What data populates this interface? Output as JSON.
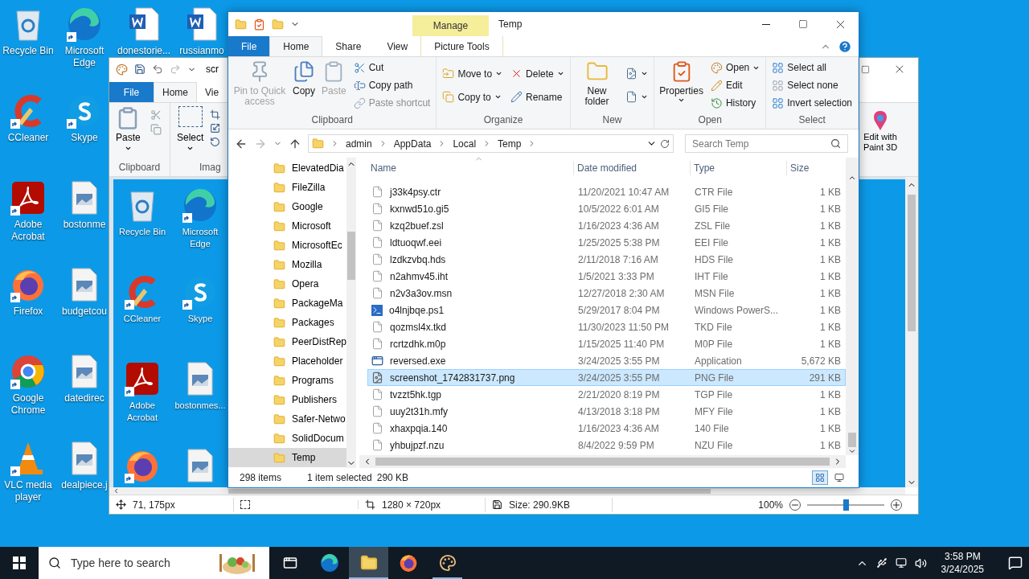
{
  "desktop_columns": [
    [
      {
        "label": "Recycle Bin",
        "kind": "recycle",
        "shortcut": false
      },
      {
        "label": "CCleaner",
        "kind": "ccleaner",
        "shortcut": true
      },
      {
        "label": "Adobe Acrobat",
        "kind": "acrobat",
        "shortcut": true
      },
      {
        "label": "Firefox",
        "kind": "firefox",
        "shortcut": true
      },
      {
        "label": "Google Chrome",
        "kind": "chrome",
        "shortcut": true
      },
      {
        "label": "VLC media player",
        "kind": "vlc",
        "shortcut": true
      }
    ],
    [
      {
        "label": "Microsoft Edge",
        "kind": "edge",
        "shortcut": true
      },
      {
        "label": "Skype",
        "kind": "skype",
        "shortcut": true
      },
      {
        "label": "bostonme",
        "kind": "image",
        "shortcut": false
      },
      {
        "label": "budgetcou",
        "kind": "image",
        "shortcut": false
      },
      {
        "label": "datedirec",
        "kind": "image",
        "shortcut": false
      },
      {
        "label": "dealpiece.j",
        "kind": "image",
        "shortcut": false
      }
    ],
    [
      {
        "label": "donestorie...",
        "kind": "word",
        "shortcut": false
      }
    ],
    [
      {
        "label": "russianmo",
        "kind": "word",
        "shortcut": false
      }
    ]
  ],
  "paint": {
    "title": "scr",
    "tabs": [
      {
        "label": "File",
        "kind": "file",
        "selected": false
      },
      {
        "label": "Home",
        "kind": "tab",
        "selected": true
      },
      {
        "label": "Vie",
        "kind": "tab",
        "selected": false
      }
    ],
    "ribbon": {
      "paste": "Paste",
      "select": "Select",
      "groups": [
        "Clipboard",
        "Imag"
      ]
    },
    "edit_3d": "Edit with Paint 3D",
    "canvas_icons": [
      {
        "label": "Recycle Bin",
        "kind": "recycle",
        "shortcut": false
      },
      {
        "label": "Microsoft Edge",
        "kind": "edge",
        "shortcut": true
      },
      {
        "label": "CCleaner",
        "kind": "ccleaner",
        "shortcut": true
      },
      {
        "label": "Skype",
        "kind": "skype",
        "shortcut": true
      },
      {
        "label": "Adobe Acrobat",
        "kind": "acrobat",
        "shortcut": true
      },
      {
        "label": "bostonmes...",
        "kind": "image",
        "shortcut": false
      },
      {
        "kind": "firefox",
        "shortcut": true
      },
      {
        "kind": "image",
        "shortcut": false
      }
    ],
    "status": {
      "position": "71, 175px",
      "dimensions": "1280 × 720px",
      "size": "Size: 290.9KB",
      "zoom": "100%",
      "zoom_slider": {
        "level": 0.5
      }
    }
  },
  "explorer": {
    "title": "Temp",
    "context_header": "Manage",
    "tabs": [
      {
        "label": "File",
        "kind": "file",
        "selected": false
      },
      {
        "label": "Home",
        "kind": "tab",
        "selected": true
      },
      {
        "label": "Share",
        "kind": "tab",
        "selected": false
      },
      {
        "label": "View",
        "kind": "tab",
        "selected": false
      },
      {
        "label": "Picture Tools",
        "kind": "context",
        "selected": false
      }
    ],
    "ribbon": [
      {
        "label": "Clipboard",
        "large": [
          {
            "label": "Pin to Quick access",
            "kind": "pin",
            "disabled": true,
            "dropdown": false
          },
          {
            "label": "Copy",
            "kind": "copy",
            "disabled": false,
            "dropdown": false
          },
          {
            "label": "Paste",
            "kind": "paste",
            "disabled": true,
            "dropdown": false
          }
        ],
        "small_columns": [
          [
            {
              "label": "Cut",
              "kind": "cut",
              "disabled": false,
              "dropdown": false
            },
            {
              "label": "Copy path",
              "kind": "path",
              "disabled": false,
              "dropdown": false
            },
            {
              "label": "Paste shortcut",
              "kind": "shortcut",
              "disabled": true,
              "dropdown": false
            }
          ]
        ]
      },
      {
        "label": "Organize",
        "small_columns": [
          [
            {
              "label": "Move to",
              "kind": "move",
              "disabled": false,
              "dropdown": true
            },
            {
              "label": "Copy to",
              "kind": "copyto",
              "disabled": false,
              "dropdown": true
            }
          ],
          [
            {
              "label": "Delete",
              "kind": "delete",
              "disabled": false,
              "dropdown": true
            },
            {
              "label": "Rename",
              "kind": "rename",
              "disabled": false,
              "dropdown": false
            }
          ]
        ]
      },
      {
        "label": "New",
        "large": [
          {
            "label": "New folder",
            "kind": "folder",
            "disabled": false,
            "dropdown": false
          }
        ],
        "small_columns": [
          [
            {
              "kind": "newitem",
              "disabled": false,
              "dropdown": true
            },
            {
              "kind": "easyaccess",
              "disabled": false,
              "dropdown": true
            }
          ]
        ]
      },
      {
        "label": "Open",
        "large": [
          {
            "label": "Properties",
            "kind": "properties",
            "disabled": false,
            "dropdown": true
          }
        ],
        "small_columns": [
          [
            {
              "label": "Open",
              "kind": "open",
              "disabled": false,
              "dropdown": true
            },
            {
              "label": "Edit",
              "kind": "edit",
              "disabled": false,
              "dropdown": false
            },
            {
              "label": "History",
              "kind": "history",
              "disabled": false,
              "dropdown": false
            }
          ]
        ]
      },
      {
        "label": "Select",
        "small_columns": [
          [
            {
              "label": "Select all",
              "kind": "selectall",
              "disabled": false,
              "dropdown": false
            },
            {
              "label": "Select none",
              "kind": "selectnone",
              "disabled": false,
              "dropdown": false
            },
            {
              "label": "Invert selection",
              "kind": "invert",
              "disabled": false,
              "dropdown": false
            }
          ]
        ]
      }
    ],
    "address": [
      "admin",
      "AppData",
      "Local",
      "Temp"
    ],
    "search": {
      "placeholder": "Search Temp"
    },
    "nav": [
      {
        "label": "ElevatedDia",
        "selected": false
      },
      {
        "label": "FileZilla",
        "selected": false
      },
      {
        "label": "Google",
        "selected": false
      },
      {
        "label": "Microsoft",
        "selected": false
      },
      {
        "label": "MicrosoftEc",
        "selected": false
      },
      {
        "label": "Mozilla",
        "selected": false
      },
      {
        "label": "Opera",
        "selected": false
      },
      {
        "label": "PackageMa",
        "selected": false
      },
      {
        "label": "Packages",
        "selected": false
      },
      {
        "label": "PeerDistRep",
        "selected": false
      },
      {
        "label": "Placeholder",
        "selected": false
      },
      {
        "label": "Programs",
        "selected": false
      },
      {
        "label": "Publishers",
        "selected": false
      },
      {
        "label": "Safer-Netwo",
        "selected": false
      },
      {
        "label": "SolidDocum",
        "selected": false
      },
      {
        "label": "Temp",
        "selected": true
      }
    ],
    "columns": [
      "Name",
      "Date modified",
      "Type",
      "Size"
    ],
    "rows": [
      {
        "name": "j33k4psy.ctr",
        "date": "11/20/2021 10:47 AM",
        "type": "CTR File",
        "size": "1 KB",
        "kind": "file",
        "selected": false
      },
      {
        "name": "kxnwd51o.gi5",
        "date": "10/5/2022 6:01 AM",
        "type": "GI5 File",
        "size": "1 KB",
        "kind": "file",
        "selected": false
      },
      {
        "name": "kzq2buef.zsl",
        "date": "1/16/2023 4:36 AM",
        "type": "ZSL File",
        "size": "1 KB",
        "kind": "file",
        "selected": false
      },
      {
        "name": "ldtuoqwf.eei",
        "date": "1/25/2025 5:38 PM",
        "type": "EEI File",
        "size": "1 KB",
        "kind": "file",
        "selected": false
      },
      {
        "name": "lzdkzvbq.hds",
        "date": "2/11/2018 7:16 AM",
        "type": "HDS File",
        "size": "1 KB",
        "kind": "file",
        "selected": false
      },
      {
        "name": "n2ahmv45.iht",
        "date": "1/5/2021 3:33 PM",
        "type": "IHT File",
        "size": "1 KB",
        "kind": "file",
        "selected": false
      },
      {
        "name": "n2v3a3ov.msn",
        "date": "12/27/2018 2:30 AM",
        "type": "MSN File",
        "size": "1 KB",
        "kind": "file",
        "selected": false
      },
      {
        "name": "o4lnjbqe.ps1",
        "date": "5/29/2017 8:04 PM",
        "type": "Windows PowerS...",
        "size": "1 KB",
        "kind": "script",
        "selected": false
      },
      {
        "name": "qozmsl4x.tkd",
        "date": "11/30/2023 11:50 PM",
        "type": "TKD File",
        "size": "1 KB",
        "kind": "file",
        "selected": false
      },
      {
        "name": "rcrtzdhk.m0p",
        "date": "1/15/2025 11:40 PM",
        "type": "M0P File",
        "size": "1 KB",
        "kind": "file",
        "selected": false
      },
      {
        "name": "reversed.exe",
        "date": "3/24/2025 3:55 PM",
        "type": "Application",
        "size": "5,672 KB",
        "kind": "exe",
        "selected": false
      },
      {
        "name": "screenshot_1742831737.png",
        "date": "3/24/2025 3:55 PM",
        "type": "PNG File",
        "size": "291 KB",
        "kind": "image",
        "selected": true
      },
      {
        "name": "tvzzt5hk.tgp",
        "date": "2/21/2020 8:19 PM",
        "type": "TGP File",
        "size": "1 KB",
        "kind": "file",
        "selected": false
      },
      {
        "name": "uuy2t31h.mfy",
        "date": "4/13/2018 3:18 PM",
        "type": "MFY File",
        "size": "1 KB",
        "kind": "file",
        "selected": false
      },
      {
        "name": "xhaxpqia.140",
        "date": "1/16/2023 4:36 AM",
        "type": "140 File",
        "size": "1 KB",
        "kind": "file",
        "selected": false
      },
      {
        "name": "yhbujpzf.nzu",
        "date": "8/4/2022 9:59 PM",
        "type": "NZU File",
        "size": "1 KB",
        "kind": "file",
        "selected": false
      }
    ],
    "status": {
      "count": "298 items",
      "selection": "1 item selected",
      "size": "290 KB"
    }
  },
  "taskbar": {
    "search": {
      "placeholder": "Type here to search"
    },
    "apps": [
      {
        "kind": "taskview",
        "selected": false,
        "running": false
      },
      {
        "kind": "edge",
        "selected": false,
        "running": false
      },
      {
        "kind": "explorer",
        "selected": true,
        "running": true
      },
      {
        "kind": "firefox",
        "selected": false,
        "running": false
      },
      {
        "kind": "paint",
        "selected": false,
        "running": true
      }
    ],
    "time": "3:58 PM",
    "date": "3/24/2025"
  }
}
